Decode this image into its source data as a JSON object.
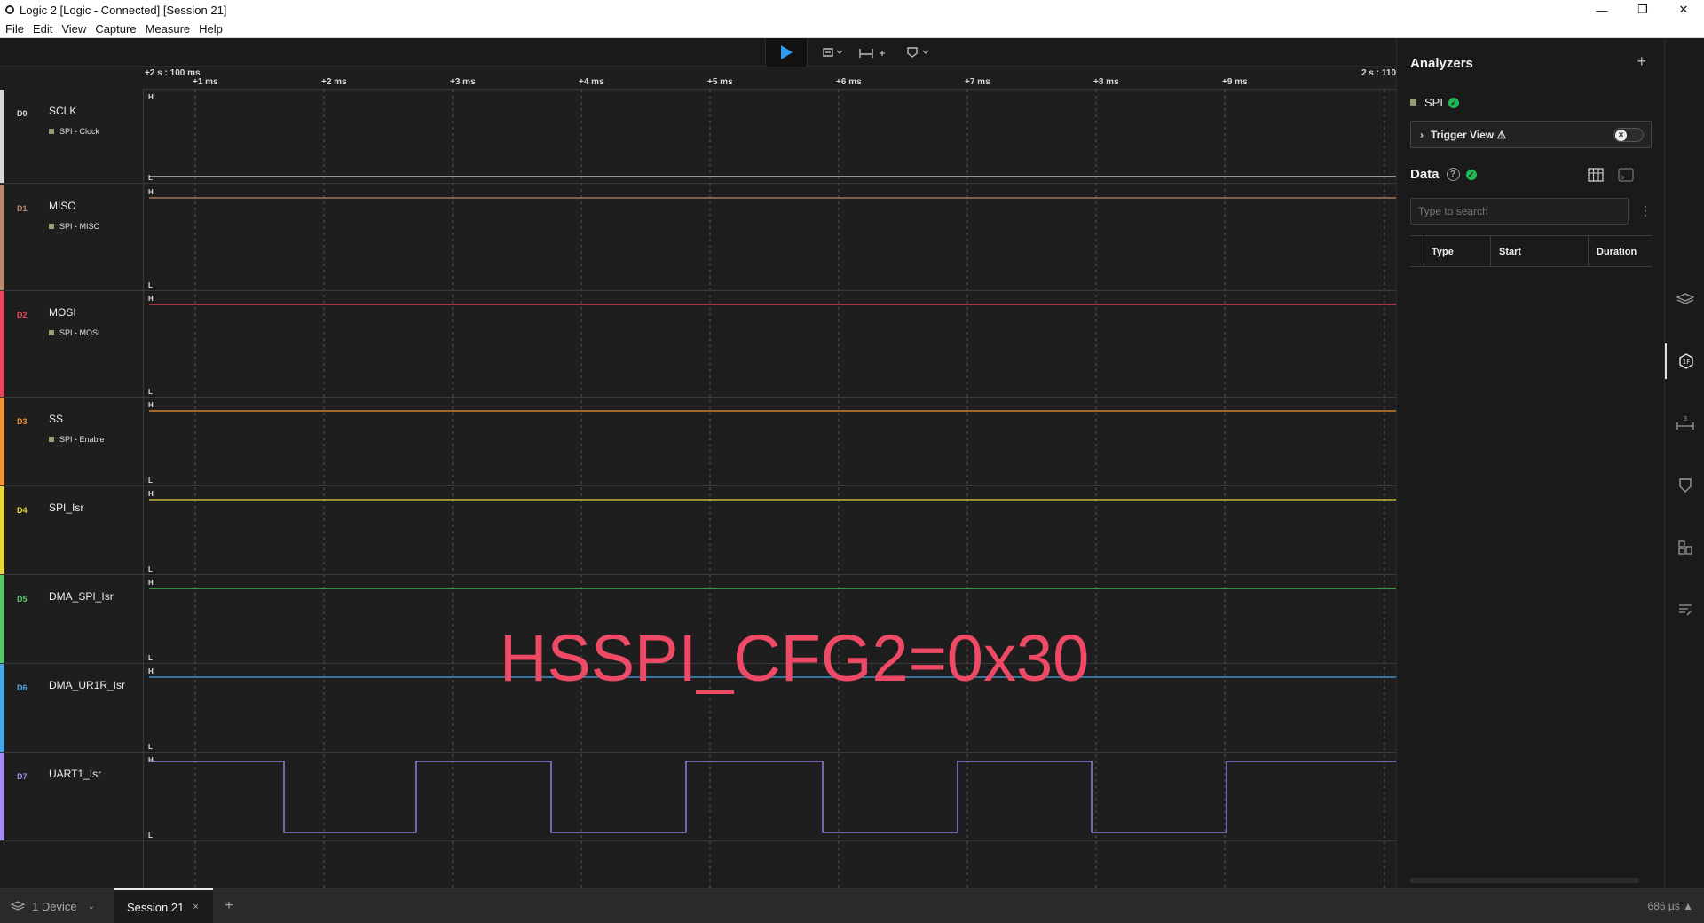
{
  "window": {
    "title": "Logic 2 [Logic - Connected] [Session 21]",
    "minimize": "—",
    "restore": "❐",
    "close": "✕"
  },
  "menu": [
    "File",
    "Edit",
    "View",
    "Capture",
    "Measure",
    "Help"
  ],
  "toolbar": {
    "play_icon": "play-icon",
    "trigger_icon": "trigger-icon",
    "measure_icon": "measure-icon",
    "marker_icon": "marker-icon"
  },
  "ruler": {
    "origin": "+2 s : 100 ms",
    "end": "2 s : 110",
    "ticks": [
      "+1 ms",
      "+2 ms",
      "+3 ms",
      "+4 ms",
      "+5 ms",
      "+6 ms",
      "+7 ms",
      "+8 ms",
      "+9 ms"
    ]
  },
  "channels": [
    {
      "id": "D0",
      "name": "SCLK",
      "analyzer": "SPI - Clock",
      "color": "#d8d8d8",
      "level": "L"
    },
    {
      "id": "D1",
      "name": "MISO",
      "analyzer": "SPI - MISO",
      "color": "#b9896b",
      "level": "H"
    },
    {
      "id": "D2",
      "name": "MOSI",
      "analyzer": "SPI - MOSI",
      "color": "#e8485f",
      "level": "H"
    },
    {
      "id": "D3",
      "name": "SS",
      "analyzer": "SPI - Enable",
      "color": "#f29235",
      "level": "H"
    },
    {
      "id": "D4",
      "name": "SPI_Isr",
      "analyzer": "",
      "color": "#e8d53a",
      "level": "H"
    },
    {
      "id": "D5",
      "name": "DMA_SPI_Isr",
      "analyzer": "",
      "color": "#5ac868",
      "level": "H"
    },
    {
      "id": "D6",
      "name": "DMA_UR1R_Isr",
      "analyzer": "",
      "color": "#4aa6e8",
      "level": "H"
    },
    {
      "id": "D7",
      "name": "UART1_Isr",
      "analyzer": "",
      "color": "#a78cf0",
      "level": "square"
    }
  ],
  "overlay_text": "HSSPI_CFG2=0x30",
  "analyzers": {
    "title": "Analyzers",
    "add": "+",
    "items": [
      {
        "name": "SPI",
        "status": "ok"
      }
    ],
    "trigger_view": "Trigger View ⚠"
  },
  "data_panel": {
    "title": "Data",
    "search_placeholder": "Type to search",
    "columns": [
      "Type",
      "Start",
      "Duration"
    ]
  },
  "bottom": {
    "device": "1 Device",
    "session": "Session 21",
    "add": "+",
    "time": "686 µs ▲"
  }
}
